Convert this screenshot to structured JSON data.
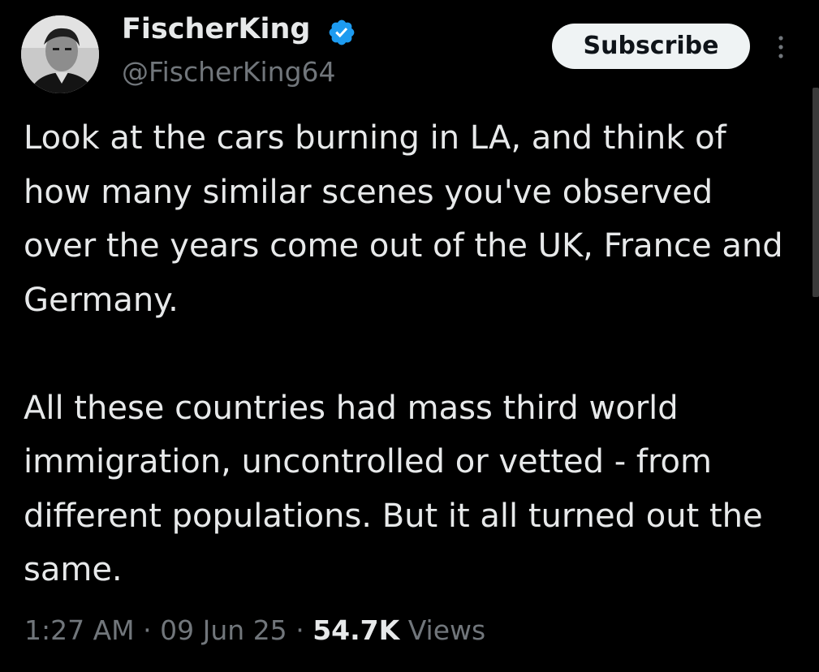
{
  "author": {
    "display_name": "FischerKing",
    "handle": "@FischerKing64",
    "verified": true,
    "verified_color": "#1d9bf0"
  },
  "header": {
    "subscribe_label": "Subscribe",
    "more_icon": "vertical-ellipsis-icon"
  },
  "tweet": {
    "paragraphs": [
      "Look at the cars burning in LA, and think of how many similar scenes you've observed over the years come out of the UK, France and Germany.",
      "All these countries had mass third world immigration, uncontrolled or vetted - from different populations. But it all turned out the same."
    ]
  },
  "meta": {
    "time": "1:27 AM",
    "separator": "·",
    "date": "09 Jun 25",
    "views_count": "54.7K",
    "views_label": "Views"
  },
  "colors": {
    "background": "#000000",
    "text_primary": "#e7e9ea",
    "text_secondary": "#71767b",
    "button_bg": "#eff3f4",
    "button_text": "#0f1419"
  }
}
